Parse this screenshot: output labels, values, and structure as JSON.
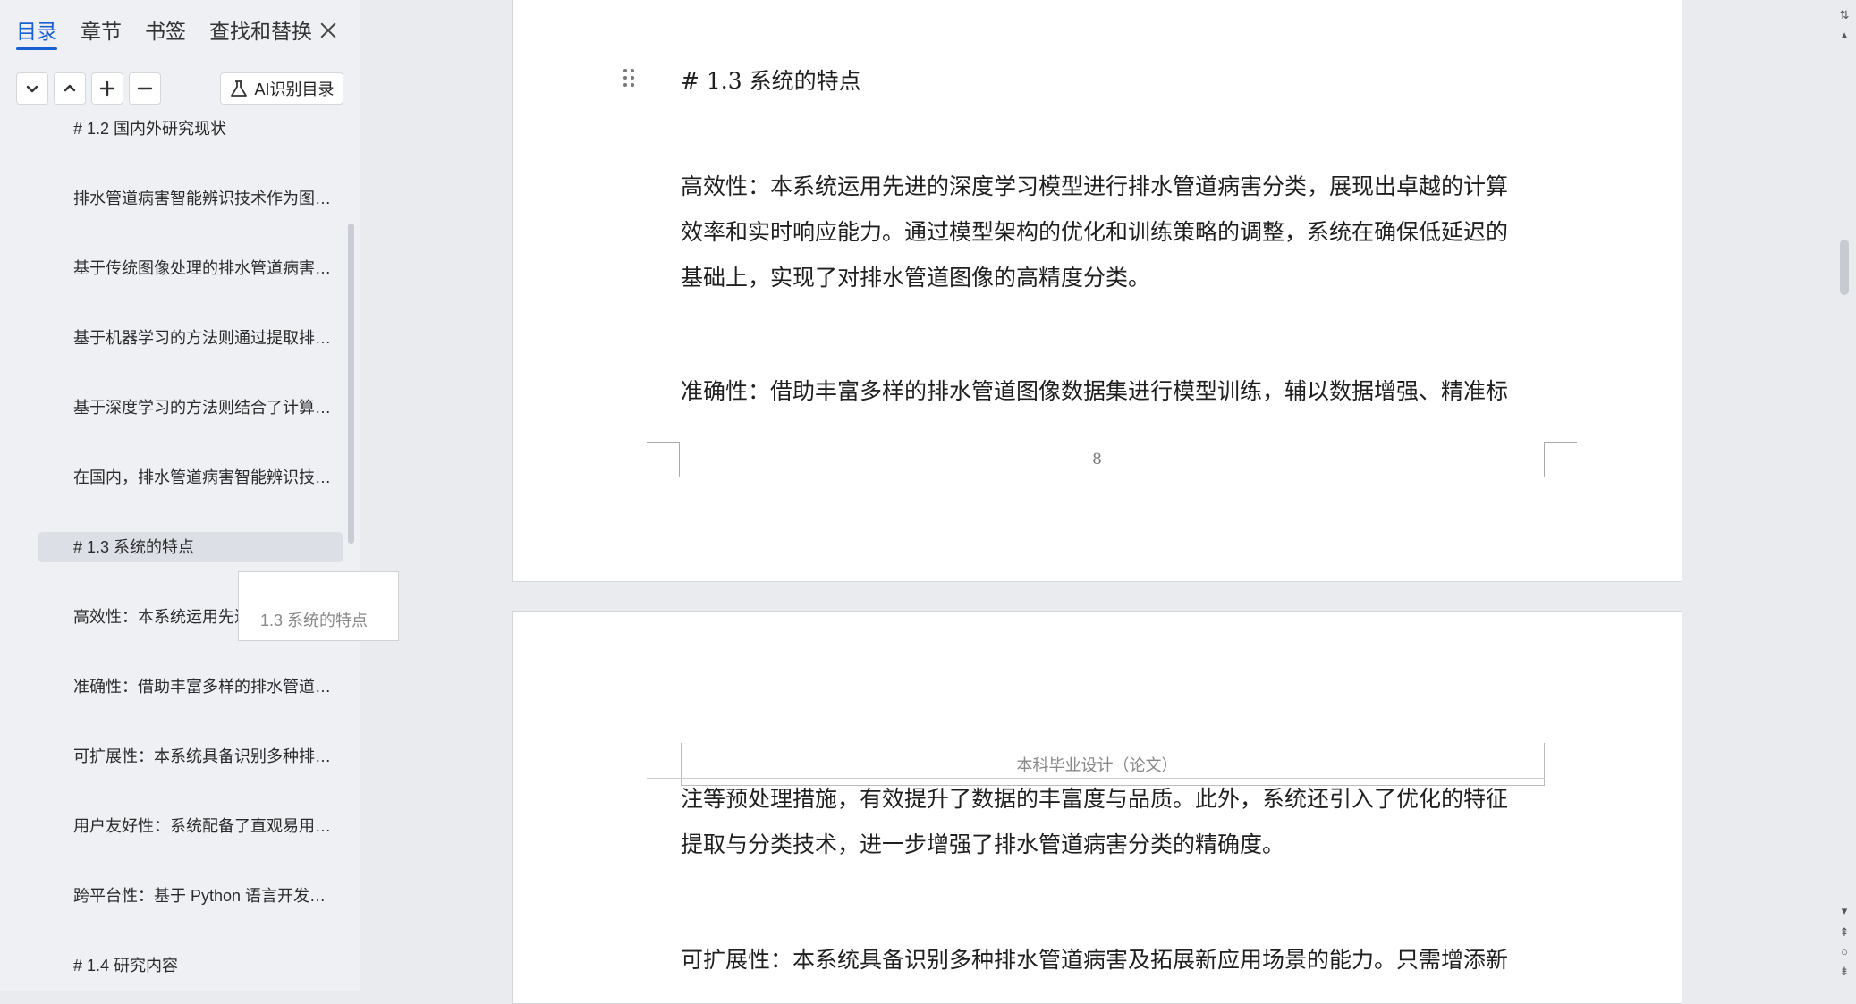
{
  "nav": {
    "tabs": [
      "目录",
      "章节",
      "书签",
      "查找和替换"
    ],
    "active_tab": "目录",
    "ai_button_label": "AI识别目录",
    "toc_items": [
      "# 1.2  国内外研究现状",
      "排水管道病害智能辨识技术作为图…",
      "基于传统图像处理的排水管道病害…",
      "基于机器学习的方法则通过提取排…",
      "基于深度学习的方法则结合了计算…",
      "在国内，排水管道病害智能辨识技…",
      "# 1.3  系统的特点",
      "高效性：本系统运用先进的深度学…",
      "准确性：借助丰富多样的排水管道…",
      "可扩展性：本系统具备识别多种排…",
      "用户友好性：系统配备了直观易用…",
      "跨平台性：基于 Python 语言开发…",
      "# 1.4  研究内容"
    ],
    "selected_index": 6,
    "tooltip": "1.3 系统的特点"
  },
  "doc": {
    "page1": {
      "heading": "# 1.3  系统的特点",
      "lines": [
        "高效性：本系统运用先进的深度学习模型进行排水管道病害分类，展现出卓越的计算",
        "效率和实时响应能力。通过模型架构的优化和训练策略的调整，系统在确保低延迟的",
        "基础上，实现了对排水管道图像的高精度分类。"
      ],
      "para2": "准确性：借助丰富多样的排水管道图像数据集进行模型训练，辅以数据增强、精准标",
      "page_number": "8"
    },
    "page2": {
      "header": "本科毕业设计（论文）",
      "lines": [
        "注等预处理措施，有效提升了数据的丰富度与品质。此外，系统还引入了优化的特征",
        "提取与分类技术，进一步增强了排水管道病害分类的精确度。"
      ],
      "para2": "可扩展性：本系统具备识别多种排水管道病害及拓展新应用场景的能力。只需增添新"
    }
  },
  "colors": {
    "accent": "#1a5fd1",
    "panel_bg": "#eef0f3",
    "doc_bg": "#e9ebef"
  }
}
